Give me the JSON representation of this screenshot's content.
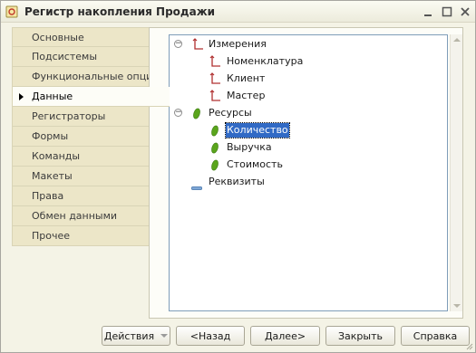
{
  "window": {
    "title": "Регистр накопления Продажи",
    "icon": "form-icon",
    "controls": [
      "minimize-icon",
      "maximize-icon",
      "close-icon"
    ]
  },
  "tabs": [
    {
      "label": "Основные",
      "active": false
    },
    {
      "label": "Подсистемы",
      "active": false
    },
    {
      "label": "Функциональные опции",
      "active": false
    },
    {
      "label": "Данные",
      "active": true
    },
    {
      "label": "Регистраторы",
      "active": false
    },
    {
      "label": "Формы",
      "active": false
    },
    {
      "label": "Команды",
      "active": false
    },
    {
      "label": "Макеты",
      "active": false
    },
    {
      "label": "Права",
      "active": false
    },
    {
      "label": "Обмен данными",
      "active": false
    },
    {
      "label": "Прочее",
      "active": false
    }
  ],
  "tree": {
    "dimensions": {
      "label": "Измерения",
      "expanded": true,
      "children": [
        "Номенклатура",
        "Клиент",
        "Мастер"
      ]
    },
    "resources": {
      "label": "Ресурсы",
      "expanded": true,
      "children": [
        "Количество",
        "Выручка",
        "Стоимость"
      ],
      "selected": "Количество"
    },
    "attributes": {
      "label": "Реквизиты"
    }
  },
  "buttons": {
    "actions": "Действия",
    "back": "<Назад",
    "next": "Далее>",
    "close": "Закрыть",
    "help": "Справка"
  },
  "colors": {
    "selection": "#316ac5",
    "resource_icon": "#5aa51c",
    "dimension_icon": "#b03030",
    "tab_background": "#ece6c8"
  }
}
